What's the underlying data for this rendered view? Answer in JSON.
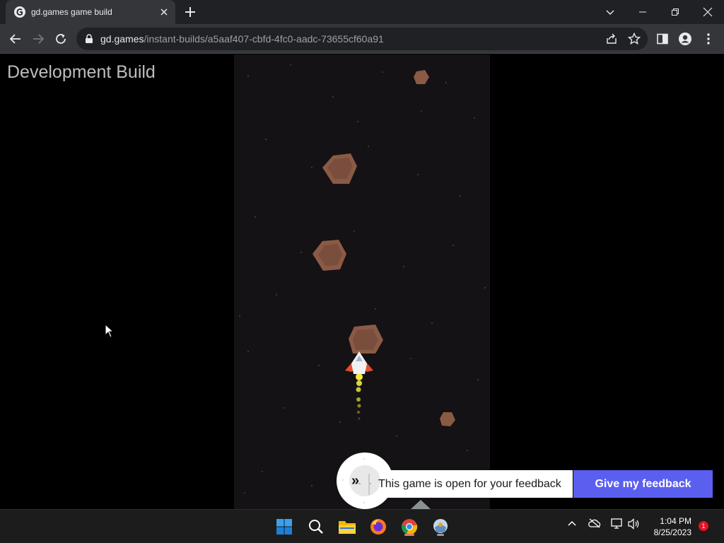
{
  "browser": {
    "tab_title": "gd.games game build",
    "url_host": "gd.games",
    "url_path": "/instant-builds/a5aaf407-cbfd-4fc0-aadc-73655cf60a91"
  },
  "page": {
    "dev_build_label": "Development Build",
    "feedback_text": "This game is open for your feedback",
    "feedback_button": "Give my feedback",
    "feedback_expand_glyph": "»"
  },
  "game": {
    "asteroids": 5,
    "player": "spaceship"
  },
  "taskbar": {
    "time": "1:04 PM",
    "date": "8/25/2023",
    "notification_count": "1",
    "apps": [
      "start-icon",
      "search-icon",
      "file-explorer-icon",
      "firefox-icon",
      "chrome-icon",
      "app-icon"
    ]
  },
  "colors": {
    "accent_button": "#5b5ff0",
    "asteroid": "#8b5a45"
  }
}
